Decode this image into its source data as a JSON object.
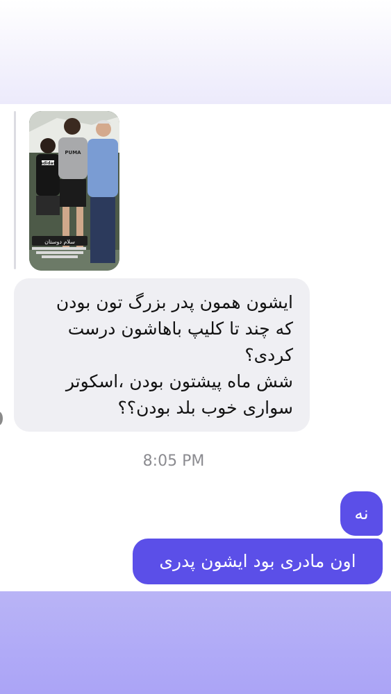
{
  "thread": {
    "story_reply": {
      "thumbnail_caption": "سلام دوستان",
      "thumbnail_logo": "adidas",
      "thumbnail_shirt_text": "PUMA"
    },
    "incoming_message": {
      "lines": [
        "ایشون همون پدر بزرگ تون بودن",
        "که چند تا کلیپ باهاشون درست",
        "کردی؟",
        "شش ماه پیشتون بودن ،اسکوتر",
        "سواری خوب بلد بودن؟؟"
      ]
    },
    "timestamp": "8:05 PM",
    "outgoing_messages": [
      {
        "text": "نه"
      },
      {
        "text": "اون مادری بود ایشون پدری"
      }
    ]
  },
  "colors": {
    "outgoing_bubble": "#5b4fe8",
    "incoming_bubble": "#efeff3",
    "timestamp_text": "#8b8b90",
    "bottom_band": "#b0aaf7"
  }
}
